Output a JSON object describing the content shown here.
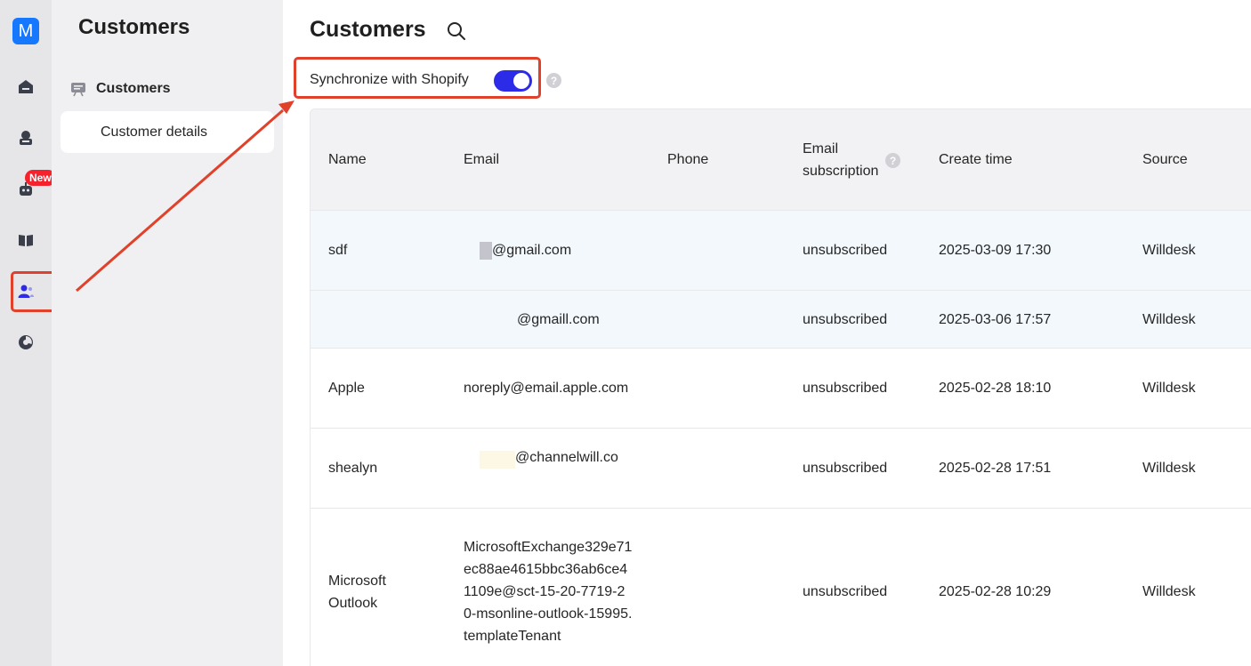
{
  "app": {
    "logo_letter": "M"
  },
  "rail": {
    "new_badge": "New",
    "icons": [
      "home-icon",
      "inbox-icon",
      "bot-icon",
      "book-icon",
      "customers-icon",
      "analytics-icon"
    ]
  },
  "sidebar": {
    "title": "Customers",
    "group_label": "Customers",
    "item_label": "Customer details"
  },
  "main": {
    "title": "Customers",
    "sync_label": "Synchronize with Shopify",
    "sync_enabled": true,
    "help_mark": "?"
  },
  "table": {
    "headers": {
      "name": "Name",
      "email": "Email",
      "phone": "Phone",
      "email_subscription": "Email subscription",
      "create_time": "Create time",
      "source": "Source"
    },
    "rows": [
      {
        "name": "sdf",
        "email": "@gmail.com",
        "phone": "",
        "subscription": "unsubscribed",
        "create_time": "2025-03-09 17:30",
        "source": "Willdesk"
      },
      {
        "name": "",
        "email": "@gmaill.com",
        "phone": "",
        "subscription": "unsubscribed",
        "create_time": "2025-03-06 17:57",
        "source": "Willdesk"
      },
      {
        "name": "Apple",
        "email": "noreply@email.apple.com",
        "phone": "",
        "subscription": "unsubscribed",
        "create_time": "2025-02-28 18:10",
        "source": "Willdesk"
      },
      {
        "name": "shealyn",
        "email": "@channelwill.co",
        "phone": "",
        "subscription": "unsubscribed",
        "create_time": "2025-02-28 17:51",
        "source": "Willdesk"
      },
      {
        "name": "Microsoft Outlook",
        "email": "MicrosoftExchange329e71ec88ae4615bbc36ab6ce41109e@sct-15-20-7719-20-msonline-outlook-15995.templateTenant",
        "phone": "",
        "subscription": "unsubscribed",
        "create_time": "2025-02-28 10:29",
        "source": "Willdesk"
      }
    ]
  },
  "colors": {
    "accent": "#2c2ce8",
    "annotation": "#e0412b",
    "logo": "#1677ff",
    "badge": "#f5222d"
  }
}
